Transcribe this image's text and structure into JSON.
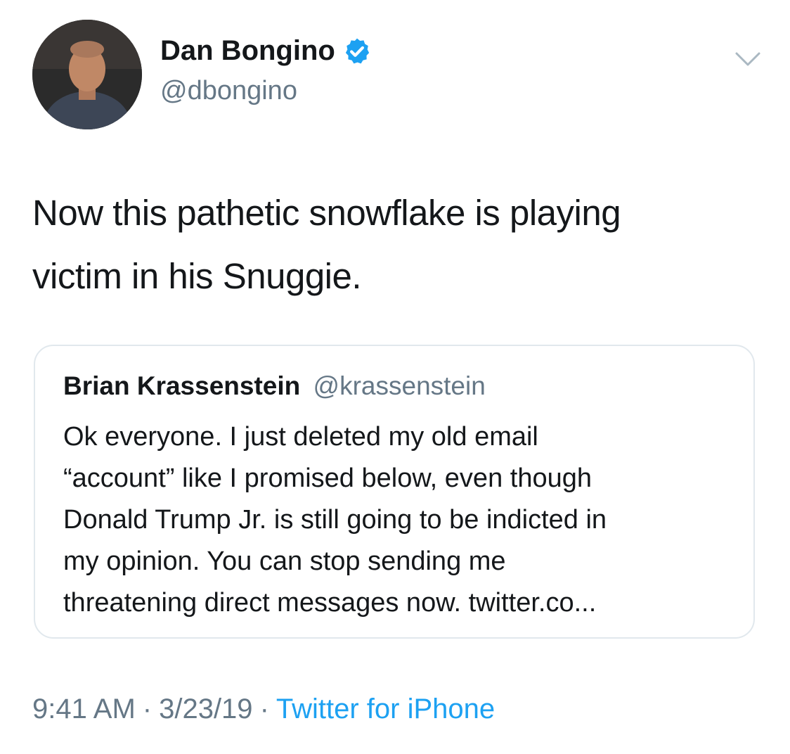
{
  "author": {
    "name": "Dan Bongino",
    "handle": "@dbongino",
    "verified_color": "#1da1f2"
  },
  "tweet": {
    "text": "Now this pathetic snowflake is playing\nvictim in his Snuggie."
  },
  "quoted_tweet": {
    "name": "Brian Krassenstein",
    "handle": "@krassenstein",
    "text": "Ok everyone. I just deleted my old email\n“account” like I promised below, even though\nDonald Trump Jr. is still going to be indicted in\nmy opinion. You can stop sending me\nthreatening direct messages now. twitter.co..."
  },
  "meta": {
    "time": "9:41 AM",
    "separator": "·",
    "date": "3/23/19",
    "source": "Twitter for iPhone",
    "source_color": "#1da1f2"
  },
  "icons": {
    "caret": "chevron-down-icon",
    "verified": "verified-badge-icon"
  }
}
